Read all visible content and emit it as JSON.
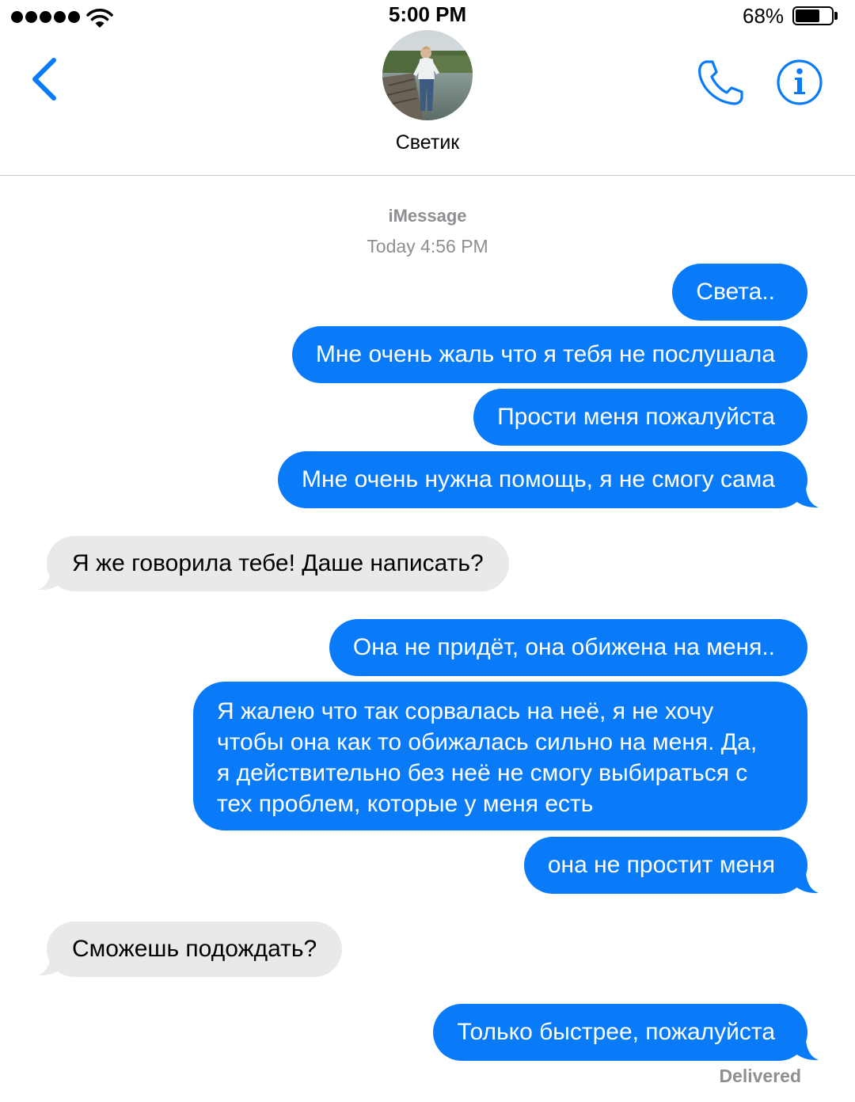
{
  "status_bar": {
    "time": "5:00 PM",
    "battery_percent": "68%",
    "battery_level": 0.68,
    "signal_bars": 5,
    "icons": [
      "signal-dots-icon",
      "wifi-icon",
      "battery-icon"
    ]
  },
  "header": {
    "contact_name": "Светик",
    "icons": [
      "chevron-left-icon",
      "phone-icon",
      "info-icon"
    ]
  },
  "thread": {
    "service": "iMessage",
    "timestamp": "Today 4:56 PM",
    "messages": [
      {
        "from": "me",
        "text": "Света.."
      },
      {
        "from": "me",
        "text": "Мне очень жаль что я тебя не послушала"
      },
      {
        "from": "me",
        "text": "Прости меня пожалуйста"
      },
      {
        "from": "me",
        "text": "Мне очень нужна помощь, я не смогу сама"
      },
      {
        "from": "them",
        "text": "Я же говорила тебе! Даше написать?"
      },
      {
        "from": "me",
        "text": "Она не придёт, она обижена на меня.."
      },
      {
        "from": "me",
        "text": "Я жалею что так сорвалась на неё, я не хочу чтобы она как то обижалась сильно на меня. Да, я действительно без неё не смогу выбираться с тех проблем, которые у меня есть"
      },
      {
        "from": "me",
        "text": "она не простит меня"
      },
      {
        "from": "them",
        "text": "Сможешь подождать?"
      },
      {
        "from": "me",
        "text": "Только быстрее, пожалуйста"
      }
    ],
    "delivered": "Delivered"
  },
  "colors": {
    "outgoing_bubble": "#0a7bf8",
    "incoming_bubble": "#e9e9eb",
    "accent": "#0a7bf8",
    "secondary_text": "#8e8e93"
  }
}
